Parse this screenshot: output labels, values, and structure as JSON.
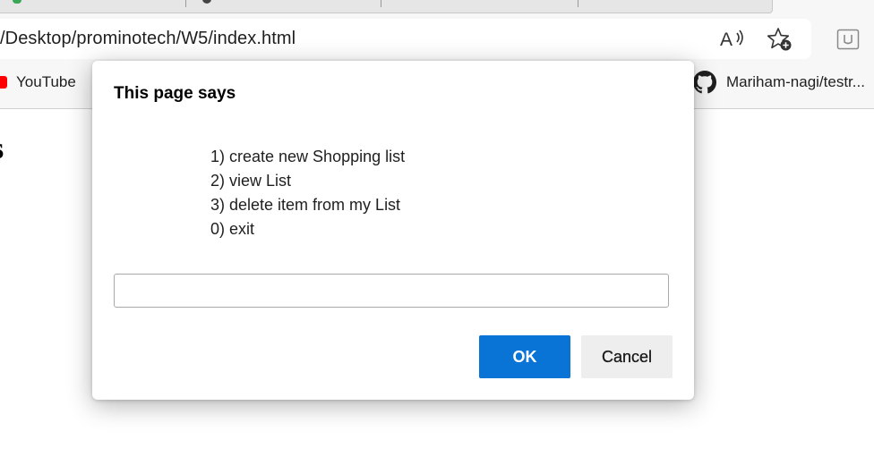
{
  "browser": {
    "url": "/Desktop/prominotech/W5/index.html",
    "bookmarks": [
      {
        "label": "YouTube",
        "icon": "youtube-icon"
      },
      {
        "label": "Mariham-nagi/testr...",
        "icon": "github-icon"
      }
    ],
    "toolbar_icons": [
      "read-aloud-icon",
      "add-favorite-icon",
      "extension-icon"
    ]
  },
  "page": {
    "heading_fragment": "s"
  },
  "dialog": {
    "title": "This page says",
    "message_lines": [
      "1) create new Shopping list",
      "2) view List",
      "3) delete item from my List",
      "0) exit"
    ],
    "input_value": "",
    "ok_label": "OK",
    "cancel_label": "Cancel"
  },
  "colors": {
    "ok_button": "#0a73d6",
    "cancel_button": "#eeeeee",
    "youtube_red": "#ff0000"
  }
}
